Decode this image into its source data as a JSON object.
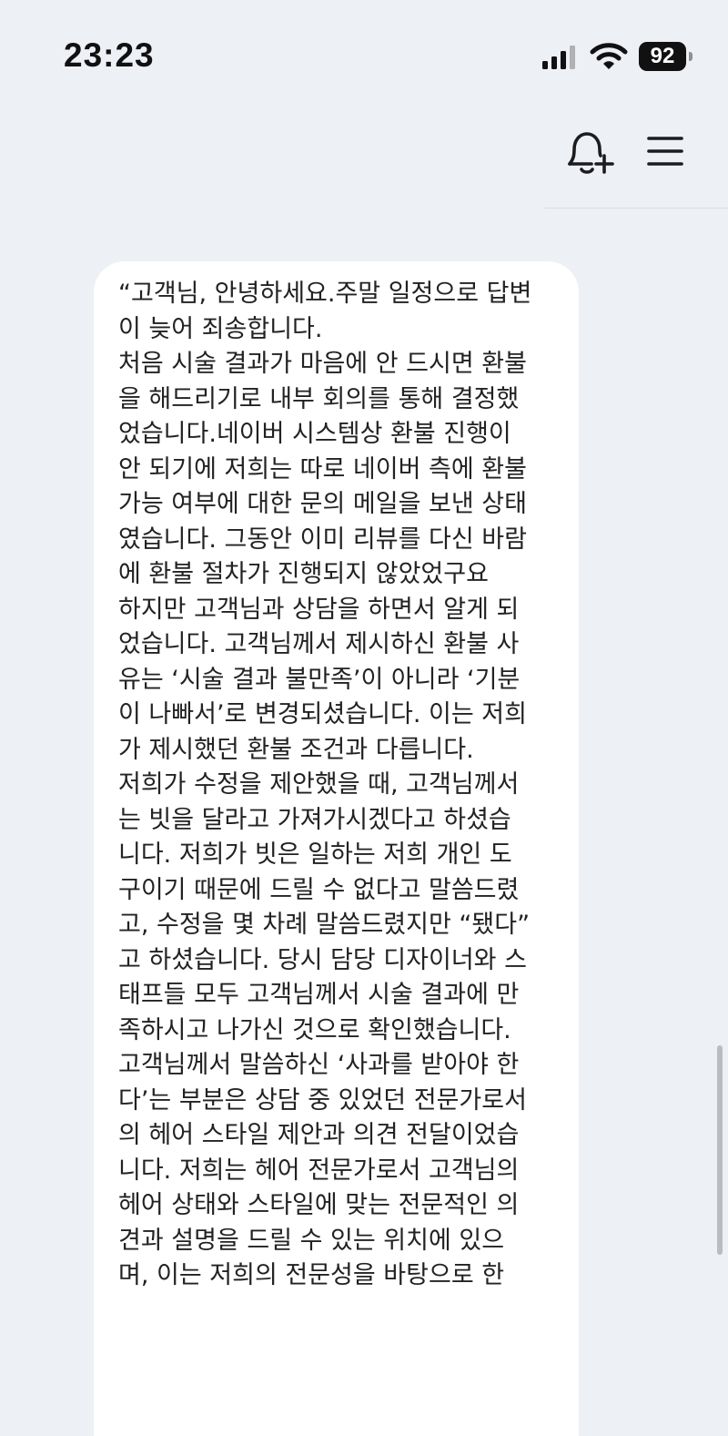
{
  "status_bar": {
    "time": "23:23",
    "battery_level": "92",
    "icons": [
      "cellular-signal-icon",
      "wifi-icon",
      "battery-icon"
    ]
  },
  "toolbar": {
    "icons": [
      "bell-add-icon",
      "menu-icon"
    ]
  },
  "message": {
    "text": "“고객님, 안녕하세요.주말 일정으로 답변\n이 늦어 죄송합니다.\n처음 시술 결과가 마음에 안 드시면 환불\n을 해드리기로 내부 회의를 통해 결정했\n었습니다.네이버 시스템상 환불 진행이\n안 되기에 저희는 따로 네이버 측에 환불\n가능 여부에 대한 문의 메일을 보낸 상태\n였습니다. 그동안 이미 리뷰를 다신 바람\n에 환불 절차가 진행되지 않았었구요\n하지만 고객님과 상담을 하면서 알게 되\n었습니다. 고객님께서 제시하신 환불 사\n유는 ‘시술 결과 불만족’이 아니라 ‘기분\n이 나빠서’로 변경되셨습니다. 이는 저희\n가 제시했던 환불 조건과 다릅니다.\n저희가 수정을 제안했을 때, 고객님께서\n는 빗을 달라고 가져가시겠다고 하셨습\n니다. 저희가 빗은 일하는 저희 개인 도\n구이기 때문에 드릴 수 없다고 말씀드렸\n고, 수정을 몇 차례 말씀드렸지만 “됐다”\n고 하셨습니다. 당시 담당 디자이너와 스\n태프들 모두 고객님께서 시술 결과에 만\n족하시고 나가신 것으로 확인했습니다.\n고객님께서 말씀하신 ‘사과를 받아야 한\n다’는 부분은 상담 중 있었던 전문가로서\n의 헤어 스타일 제안과 의견 전달이었습\n니다. 저희는 헤어 전문가로서 고객님의\n헤어 상태와 스타일에 맞는 전문적인 의\n견과 설명을 드릴 수 있는 위치에 있으\n며, 이는 저희의 전문성을 바탕으로 한"
  }
}
